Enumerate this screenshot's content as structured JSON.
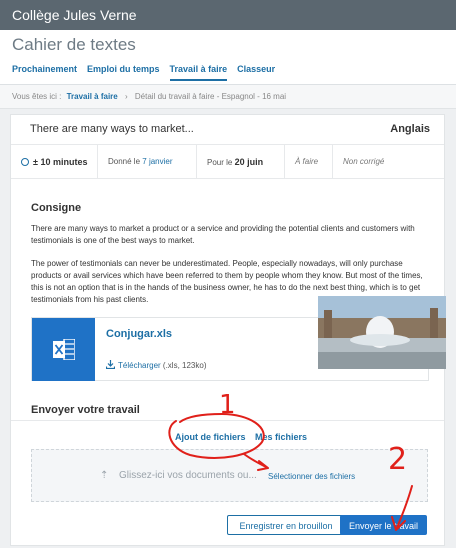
{
  "app": {
    "title": "Collège Jules Verne"
  },
  "header": {
    "page_title": "Cahier de textes",
    "tabs": [
      {
        "label": "Prochainement"
      },
      {
        "label": "Emploi du temps"
      },
      {
        "label": "Travail à faire"
      },
      {
        "label": "Classeur"
      }
    ]
  },
  "breadcrumb": {
    "prefix": "Vous êtes ici :",
    "link": "Travail à faire",
    "separator": "›",
    "current": "Détail du travail à faire - Espagnol - 16 mai"
  },
  "homework": {
    "title": "There are many ways to market...",
    "subject": "Anglais",
    "duration": "± 10 minutes",
    "given_label": "Donné le",
    "given_date": "7 janvier",
    "due_label": "Pour le",
    "due_date": "20 juin",
    "status": "À faire",
    "correction": "Non corrigé"
  },
  "consigne": {
    "label": "Consigne",
    "paragraphs": [
      "There are many ways to market a product or a service and providing the potential clients and customers with testimonials is one of the best ways to market.",
      "The power of testimonials can never be underestimated. People, especially nowadays, will only purchase products or avail services which have been referred to them by people whom they know. But most of the times, this is not an option that is in the hands of the business owner, he has to do the next best thing, which is to get testimonials from his past clients."
    ]
  },
  "attachment": {
    "file_name": "Conjugar.xls",
    "download_label": "Télécharger",
    "file_info": "(.xls, 123ko)",
    "icon": "excel-file-icon"
  },
  "submission": {
    "label": "Envoyer votre travail",
    "tabs": [
      {
        "label": "Ajout de fichiers"
      },
      {
        "label": "Mes fichiers"
      }
    ],
    "dropzone_text": "Glissez-ici vos documents ou...",
    "select_link": "Sélectionner des fichiers",
    "draft_button": "Enregistrer en brouillon",
    "send_button": "Envoyer le travail"
  },
  "annotations": {
    "step_one": "1",
    "step_two": "2",
    "color": "#e0201a"
  },
  "colors": {
    "topbar": "#5b6770",
    "accent": "#1d6fa5",
    "primary_button": "#1f72c6"
  }
}
